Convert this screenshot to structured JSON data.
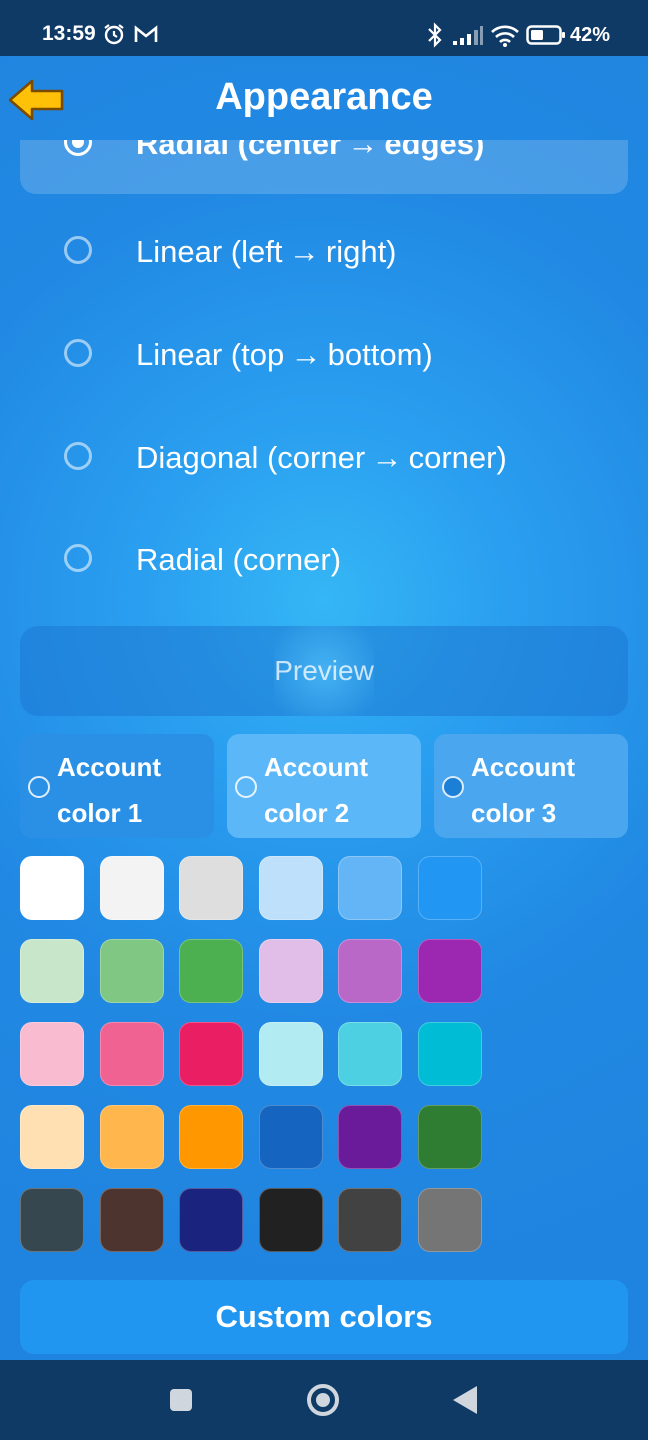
{
  "status_bar": {
    "time": "13:59",
    "battery": "42%"
  },
  "header": {
    "title": "Appearance",
    "back_icon": "arrow-left-icon"
  },
  "gradient_options": [
    {
      "label": "Radial (center → edges)",
      "selected": true
    },
    {
      "label": "Linear (left → right)",
      "selected": false
    },
    {
      "label": "Linear (top → bottom)",
      "selected": false
    },
    {
      "label": "Diagonal (corner → corner)",
      "selected": false
    },
    {
      "label": "Radial (corner)",
      "selected": false
    }
  ],
  "preview": {
    "label": "Preview"
  },
  "account_colors": [
    {
      "line1": "Account",
      "line2": "color 1",
      "bg": "#2a90e6",
      "radio_fill": ""
    },
    {
      "line1": "Account",
      "line2": "color 2",
      "bg": "#5bb7f7",
      "radio_fill": ""
    },
    {
      "line1": "Account",
      "line2": "color 3",
      "bg": "#4aa6ef",
      "radio_fill": "#1c7fd6"
    }
  ],
  "palette": [
    [
      "#ffffff",
      "#f3f3f3",
      "#dedede",
      "#bfe0fb",
      "#64b5f6",
      "#2196f3"
    ],
    [
      "#c8e6c9",
      "#81c784",
      "#4caf50",
      "#e1bee7",
      "#ba68c8",
      "#9c27b0"
    ],
    [
      "#f8bbd0",
      "#f06292",
      "#e91e63",
      "#b2ebf2",
      "#4dd0e1",
      "#00bcd4"
    ],
    [
      "#ffe0b2",
      "#ffb74d",
      "#ff9800",
      "#1565c0",
      "#6a1b9a",
      "#2e7d32"
    ],
    [
      "#37474f",
      "#4e342e",
      "#1a237e",
      "#212121",
      "#424242",
      "#757575"
    ]
  ],
  "custom_colors_button": "Custom colors"
}
